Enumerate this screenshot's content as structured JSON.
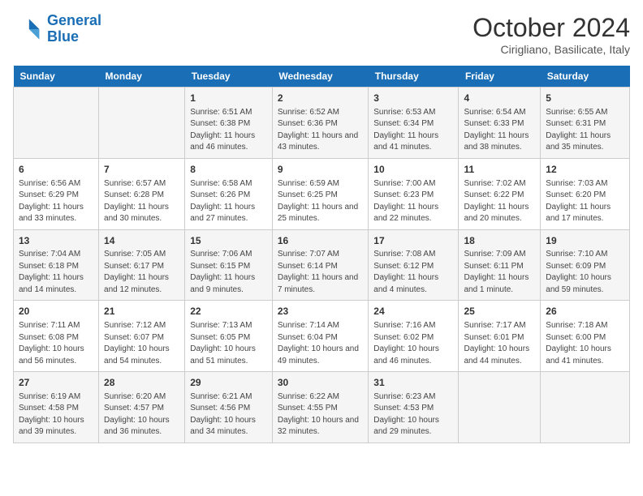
{
  "logo": {
    "line1": "General",
    "line2": "Blue"
  },
  "title": "October 2024",
  "subtitle": "Cirigliano, Basilicate, Italy",
  "days_of_week": [
    "Sunday",
    "Monday",
    "Tuesday",
    "Wednesday",
    "Thursday",
    "Friday",
    "Saturday"
  ],
  "weeks": [
    [
      {
        "day": "",
        "content": ""
      },
      {
        "day": "",
        "content": ""
      },
      {
        "day": "1",
        "content": "Sunrise: 6:51 AM\nSunset: 6:38 PM\nDaylight: 11 hours and 46 minutes."
      },
      {
        "day": "2",
        "content": "Sunrise: 6:52 AM\nSunset: 6:36 PM\nDaylight: 11 hours and 43 minutes."
      },
      {
        "day": "3",
        "content": "Sunrise: 6:53 AM\nSunset: 6:34 PM\nDaylight: 11 hours and 41 minutes."
      },
      {
        "day": "4",
        "content": "Sunrise: 6:54 AM\nSunset: 6:33 PM\nDaylight: 11 hours and 38 minutes."
      },
      {
        "day": "5",
        "content": "Sunrise: 6:55 AM\nSunset: 6:31 PM\nDaylight: 11 hours and 35 minutes."
      }
    ],
    [
      {
        "day": "6",
        "content": "Sunrise: 6:56 AM\nSunset: 6:29 PM\nDaylight: 11 hours and 33 minutes."
      },
      {
        "day": "7",
        "content": "Sunrise: 6:57 AM\nSunset: 6:28 PM\nDaylight: 11 hours and 30 minutes."
      },
      {
        "day": "8",
        "content": "Sunrise: 6:58 AM\nSunset: 6:26 PM\nDaylight: 11 hours and 27 minutes."
      },
      {
        "day": "9",
        "content": "Sunrise: 6:59 AM\nSunset: 6:25 PM\nDaylight: 11 hours and 25 minutes."
      },
      {
        "day": "10",
        "content": "Sunrise: 7:00 AM\nSunset: 6:23 PM\nDaylight: 11 hours and 22 minutes."
      },
      {
        "day": "11",
        "content": "Sunrise: 7:02 AM\nSunset: 6:22 PM\nDaylight: 11 hours and 20 minutes."
      },
      {
        "day": "12",
        "content": "Sunrise: 7:03 AM\nSunset: 6:20 PM\nDaylight: 11 hours and 17 minutes."
      }
    ],
    [
      {
        "day": "13",
        "content": "Sunrise: 7:04 AM\nSunset: 6:18 PM\nDaylight: 11 hours and 14 minutes."
      },
      {
        "day": "14",
        "content": "Sunrise: 7:05 AM\nSunset: 6:17 PM\nDaylight: 11 hours and 12 minutes."
      },
      {
        "day": "15",
        "content": "Sunrise: 7:06 AM\nSunset: 6:15 PM\nDaylight: 11 hours and 9 minutes."
      },
      {
        "day": "16",
        "content": "Sunrise: 7:07 AM\nSunset: 6:14 PM\nDaylight: 11 hours and 7 minutes."
      },
      {
        "day": "17",
        "content": "Sunrise: 7:08 AM\nSunset: 6:12 PM\nDaylight: 11 hours and 4 minutes."
      },
      {
        "day": "18",
        "content": "Sunrise: 7:09 AM\nSunset: 6:11 PM\nDaylight: 11 hours and 1 minute."
      },
      {
        "day": "19",
        "content": "Sunrise: 7:10 AM\nSunset: 6:09 PM\nDaylight: 10 hours and 59 minutes."
      }
    ],
    [
      {
        "day": "20",
        "content": "Sunrise: 7:11 AM\nSunset: 6:08 PM\nDaylight: 10 hours and 56 minutes."
      },
      {
        "day": "21",
        "content": "Sunrise: 7:12 AM\nSunset: 6:07 PM\nDaylight: 10 hours and 54 minutes."
      },
      {
        "day": "22",
        "content": "Sunrise: 7:13 AM\nSunset: 6:05 PM\nDaylight: 10 hours and 51 minutes."
      },
      {
        "day": "23",
        "content": "Sunrise: 7:14 AM\nSunset: 6:04 PM\nDaylight: 10 hours and 49 minutes."
      },
      {
        "day": "24",
        "content": "Sunrise: 7:16 AM\nSunset: 6:02 PM\nDaylight: 10 hours and 46 minutes."
      },
      {
        "day": "25",
        "content": "Sunrise: 7:17 AM\nSunset: 6:01 PM\nDaylight: 10 hours and 44 minutes."
      },
      {
        "day": "26",
        "content": "Sunrise: 7:18 AM\nSunset: 6:00 PM\nDaylight: 10 hours and 41 minutes."
      }
    ],
    [
      {
        "day": "27",
        "content": "Sunrise: 6:19 AM\nSunset: 4:58 PM\nDaylight: 10 hours and 39 minutes."
      },
      {
        "day": "28",
        "content": "Sunrise: 6:20 AM\nSunset: 4:57 PM\nDaylight: 10 hours and 36 minutes."
      },
      {
        "day": "29",
        "content": "Sunrise: 6:21 AM\nSunset: 4:56 PM\nDaylight: 10 hours and 34 minutes."
      },
      {
        "day": "30",
        "content": "Sunrise: 6:22 AM\nSunset: 4:55 PM\nDaylight: 10 hours and 32 minutes."
      },
      {
        "day": "31",
        "content": "Sunrise: 6:23 AM\nSunset: 4:53 PM\nDaylight: 10 hours and 29 minutes."
      },
      {
        "day": "",
        "content": ""
      },
      {
        "day": "",
        "content": ""
      }
    ]
  ]
}
